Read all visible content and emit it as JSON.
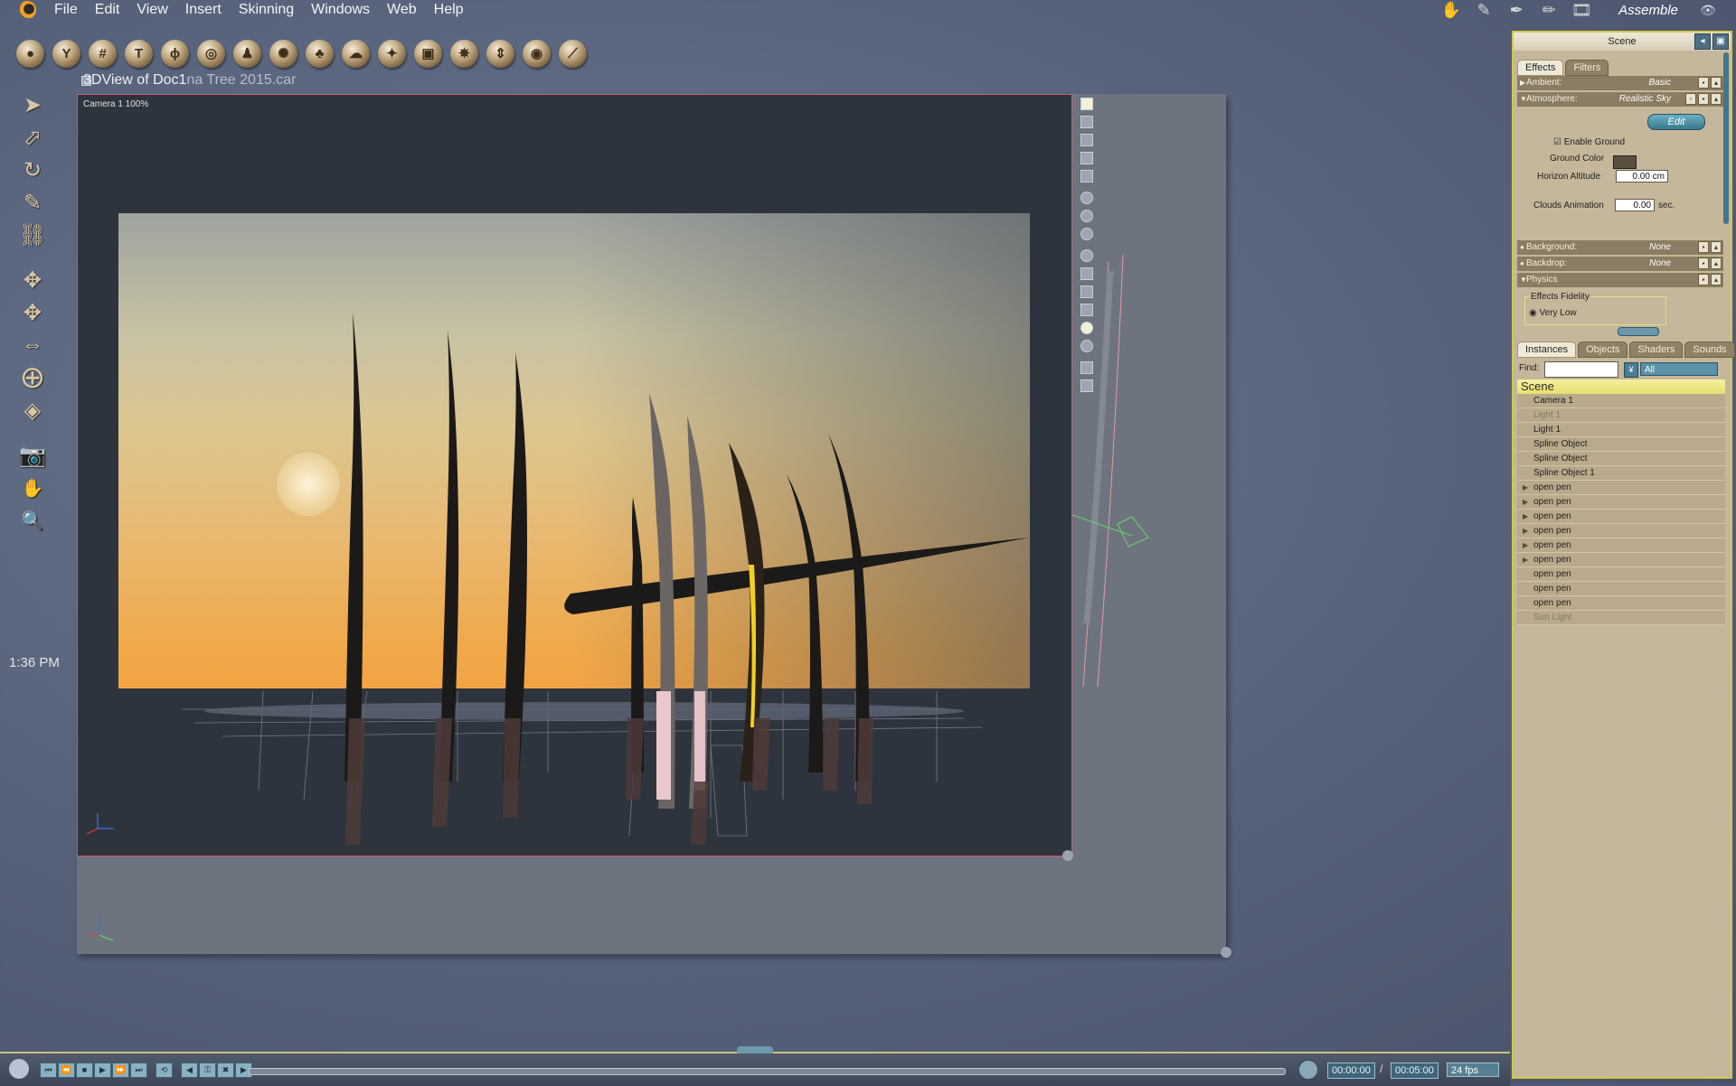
{
  "menu": [
    "File",
    "Edit",
    "View",
    "Insert",
    "Skinning",
    "Windows",
    "Web",
    "Help"
  ],
  "room": {
    "label": "Assemble"
  },
  "clock": "1:36 PM",
  "document": {
    "title_main": "3DView of Doc1",
    "title_dim": "na Tree 2015.car",
    "camera_label": "Camera 1 100%"
  },
  "panel": {
    "title": "Scene",
    "effect_tabs": [
      "Effects",
      "Filters"
    ],
    "ambient": {
      "label": "Ambient:",
      "value": "Basic"
    },
    "atmosphere": {
      "label": "Atmosphere:",
      "value": "Realistic Sky"
    },
    "edit_label": "Edit",
    "enable_ground": "Enable Ground",
    "ground_color": "Ground Color",
    "horizon_altitude": {
      "label": "Horizon Altitude",
      "value": "0.00 cm"
    },
    "clouds_animation": {
      "label": "Clouds Animation",
      "value": "0.00",
      "unit": "sec."
    },
    "background": {
      "label": "Background:",
      "value": "None"
    },
    "backdrop": {
      "label": "Backdrop:",
      "value": "None"
    },
    "physics": {
      "label": "Physics"
    },
    "effects_fidelity": {
      "label": "Effects Fidelity",
      "value": "Very Low"
    },
    "instance_tabs": [
      "Instances",
      "Objects",
      "Shaders",
      "Sounds"
    ],
    "find_label": "Find:",
    "find_value": "",
    "filter_value": "All",
    "scene_header": "Scene",
    "instances": [
      {
        "name": "Camera 1",
        "dim": false,
        "expandable": false
      },
      {
        "name": "Light 1",
        "dim": true,
        "expandable": false
      },
      {
        "name": "Light 1",
        "dim": false,
        "expandable": false
      },
      {
        "name": "Spline Object",
        "dim": false,
        "expandable": false
      },
      {
        "name": "Spline Object",
        "dim": false,
        "expandable": false
      },
      {
        "name": "Spline Object 1",
        "dim": false,
        "expandable": false
      },
      {
        "name": "open pen",
        "dim": false,
        "expandable": true
      },
      {
        "name": "open pen",
        "dim": false,
        "expandable": true
      },
      {
        "name": "open pen",
        "dim": false,
        "expandable": true
      },
      {
        "name": "open pen",
        "dim": false,
        "expandable": true
      },
      {
        "name": "open pen",
        "dim": false,
        "expandable": true
      },
      {
        "name": "open pen",
        "dim": false,
        "expandable": true
      },
      {
        "name": "open pen",
        "dim": false,
        "expandable": false
      },
      {
        "name": "open pen",
        "dim": false,
        "expandable": false
      },
      {
        "name": "open pen",
        "dim": false,
        "expandable": false
      },
      {
        "name": "Sun Light",
        "dim": true,
        "expandable": false
      }
    ]
  },
  "timeline": {
    "current_time": "00:00:00",
    "separator": "/",
    "end_time": "00:05:00",
    "fps": "24 fps"
  },
  "colors": {
    "accent": "#d4c74a",
    "viewport_border": "#d35a6a",
    "panel": "#c4b79b"
  }
}
